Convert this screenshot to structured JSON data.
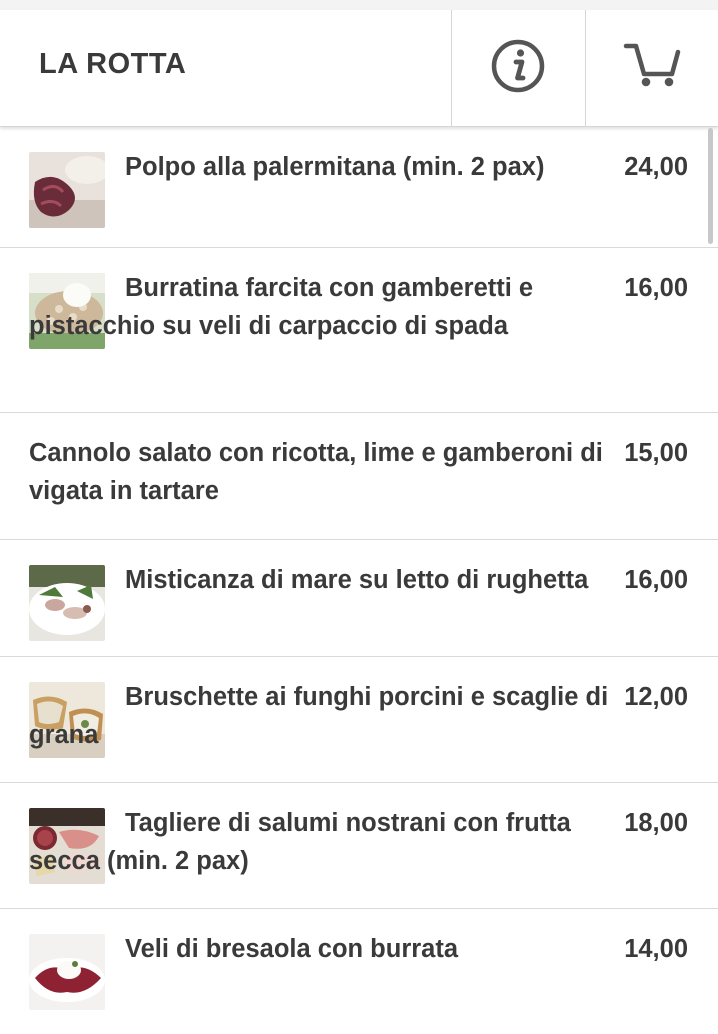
{
  "header": {
    "brand": "LA ROTTA",
    "info_icon": "info-icon",
    "cart_icon": "cart-icon"
  },
  "menu": {
    "items": [
      {
        "name": "Polpo alla palermitana (min. 2 pax)",
        "price": "24,00",
        "image": "octopus-dish-photo"
      },
      {
        "name": "Burratina farcita con gamberetti e pistacchio su veli di carpaccio di spada",
        "price": "16,00",
        "image": "burrata-dish-photo"
      },
      {
        "name": "Cannolo salato con ricotta, lime e gamberoni di vigata in tartare",
        "price": "15,00",
        "image": null
      },
      {
        "name": "Misticanza di mare su letto di rughetta",
        "price": "16,00",
        "image": "seafood-salad-photo"
      },
      {
        "name": "Bruschette ai funghi porcini e scaglie di grana",
        "price": "12,00",
        "image": "bruschetta-photo"
      },
      {
        "name": "Tagliere di salumi nostrani con frutta secca (min. 2 pax)",
        "price": "18,00",
        "image": "cured-meats-board-photo"
      },
      {
        "name": "Veli di bresaola con burrata",
        "price": "14,00",
        "image": "bresaola-burrata-photo"
      }
    ]
  },
  "colors": {
    "text": "#3a3a3a",
    "divider": "#d9d9d9",
    "icon": "#555555",
    "background": "#ffffff"
  }
}
